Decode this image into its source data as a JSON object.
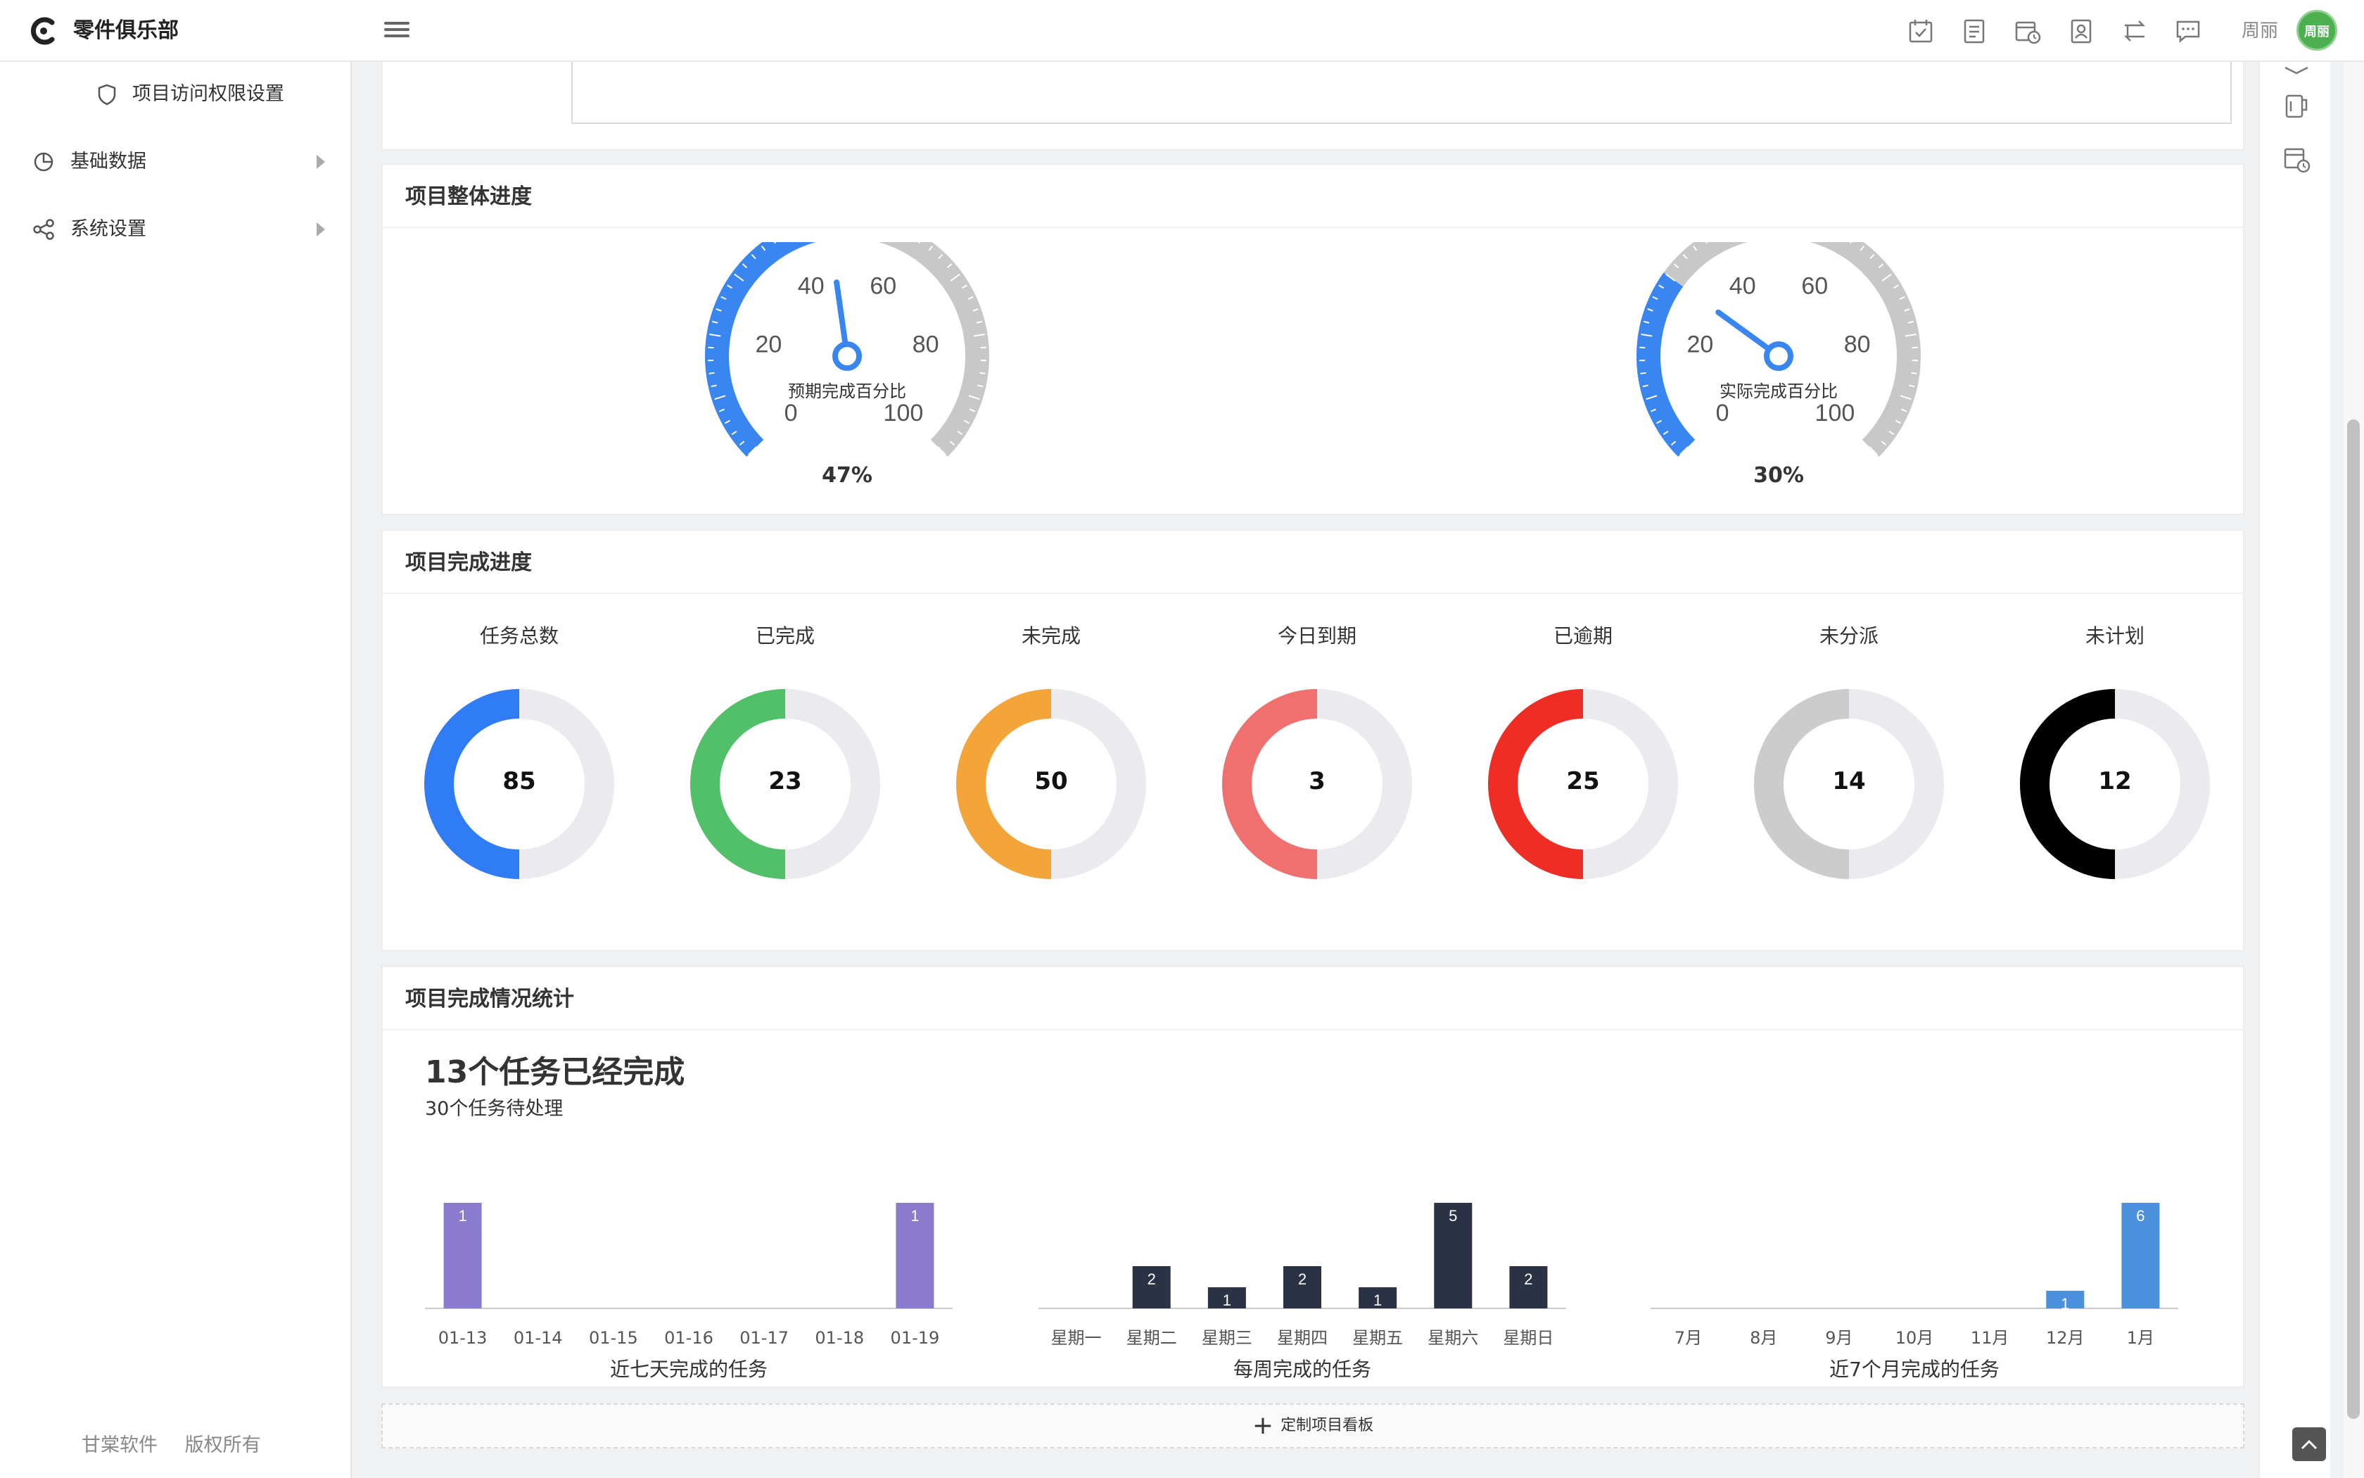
{
  "app": {
    "brand": "零件俱乐部",
    "user_name": "周丽",
    "avatar_text": "周丽",
    "accent": "#3a86f0"
  },
  "sidebar": {
    "items": [
      {
        "label": "项目访问权限设置",
        "icon": "shield-icon"
      },
      {
        "label": "基础数据",
        "icon": "pie-chart-icon",
        "has_submenu": true
      },
      {
        "label": "系统设置",
        "icon": "share-icon",
        "has_submenu": true
      }
    ],
    "footer": [
      "甘棠软件",
      "版权所有"
    ]
  },
  "topbar_icons": [
    "calendar-check-icon",
    "document-icon",
    "calendar-clock-icon",
    "contact-card-icon",
    "swap-icon",
    "chat-icon"
  ],
  "rail_icons": [
    "layers-icon",
    "mug-icon",
    "calendar-clock-icon"
  ],
  "overall_progress": {
    "title": "项目整体进度",
    "gauges": [
      {
        "label": "预期完成百分比",
        "value": 47,
        "display": "47%",
        "ticks": [
          "0",
          "20",
          "40",
          "60",
          "80",
          "100"
        ]
      },
      {
        "label": "实际完成百分比",
        "value": 30,
        "display": "30%",
        "ticks": [
          "0",
          "20",
          "40",
          "60",
          "80",
          "100"
        ]
      }
    ]
  },
  "completion": {
    "title": "项目完成进度",
    "items": [
      {
        "label": "任务总数",
        "value": "85",
        "color": "#2f7cf6"
      },
      {
        "label": "已完成",
        "value": "23",
        "color": "#52bf69"
      },
      {
        "label": "未完成",
        "value": "50",
        "color": "#f3a53a"
      },
      {
        "label": "今日到期",
        "value": "3",
        "color": "#f06f6f"
      },
      {
        "label": "已逾期",
        "value": "25",
        "color": "#ee2e25"
      },
      {
        "label": "未分派",
        "value": "14",
        "color": "#cccccc"
      },
      {
        "label": "未计划",
        "value": "12",
        "color": "#000000"
      }
    ]
  },
  "stats": {
    "title": "项目完成情况统计",
    "headline": "13个任务已经完成",
    "subline": "30个任务待处理"
  },
  "chart_data": [
    {
      "type": "bar",
      "title": "近七天完成的任务",
      "categories": [
        "01-13",
        "01-14",
        "01-15",
        "01-16",
        "01-17",
        "01-18",
        "01-19"
      ],
      "values": [
        1,
        0,
        0,
        0,
        0,
        0,
        1
      ],
      "color": "#8a7bcf"
    },
    {
      "type": "bar",
      "title": "每周完成的任务",
      "categories": [
        "星期一",
        "星期二",
        "星期三",
        "星期四",
        "星期五",
        "星期六",
        "星期日"
      ],
      "values": [
        0,
        2,
        1,
        2,
        1,
        5,
        2
      ],
      "color": "#2b3245"
    },
    {
      "type": "bar",
      "title": "近7个月完成的任务",
      "categories": [
        "7月",
        "8月",
        "9月",
        "10月",
        "11月",
        "12月",
        "1月"
      ],
      "values": [
        0,
        0,
        0,
        0,
        0,
        1,
        6
      ],
      "color": "#4a90dc"
    }
  ],
  "customize_button": "定制项目看板"
}
